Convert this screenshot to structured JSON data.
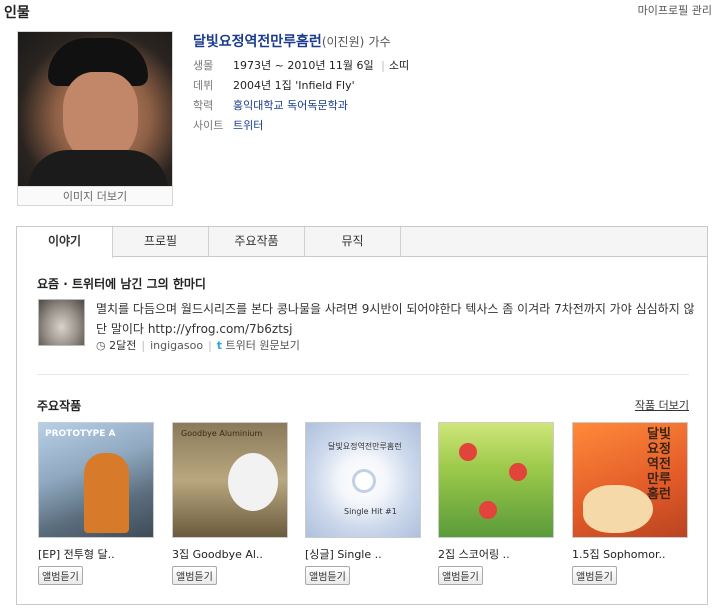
{
  "header": {
    "title": "인물",
    "manage_link": "마이프로필 관리"
  },
  "profile": {
    "name": "달빛요정역전만루홈런",
    "real_name": "(이진원)",
    "job": "가수",
    "photo_more": "이미지 더보기",
    "fields": [
      {
        "label": "생몰",
        "value": "1973년 ~ 2010년 11월 6일",
        "extra": "소띠"
      },
      {
        "label": "데뷔",
        "value": "2004년 1집 'Infield Fly'"
      },
      {
        "label": "학력",
        "value": "홍익대학교 독어독문학과"
      },
      {
        "label": "사이트",
        "value": "트위터"
      }
    ]
  },
  "tabs": [
    "이야기",
    "프로필",
    "주요작품",
    "뮤직"
  ],
  "tweet_section": {
    "title": "요즘 · 트위터에 남긴 그의 한마디",
    "text": "멸치를 다듬으며 월드시리즈를 본다 콩나물을 사려면 9시반이 되어야한다 텍사스 좀 이겨라 7차전까지 가야 심심하지 않단 말이다",
    "url": "http://yfrog.com/7b6ztsj",
    "ago": "2달전",
    "user": "ingigasoo",
    "source": "트위터 원문보기"
  },
  "works": {
    "title": "주요작품",
    "more": "작품 더보기",
    "button_label": "앨범듣기",
    "albums": [
      {
        "title": "[EP] 전투형 달..",
        "cover_label": "PROTOTYPE A"
      },
      {
        "title": "3집 Goodbye Al..",
        "cover_label": "Goodbye Aluminium"
      },
      {
        "title": "[싱글] Single ..",
        "cover_label": "달빛요정역전만루홈런",
        "cover_label2": "Single Hit #1"
      },
      {
        "title": "2집 스코어링 ..",
        "cover_label": ""
      },
      {
        "title": "1.5집 Sophomor..",
        "cover_label": "달빛요정 역전 만루홈런"
      }
    ]
  }
}
